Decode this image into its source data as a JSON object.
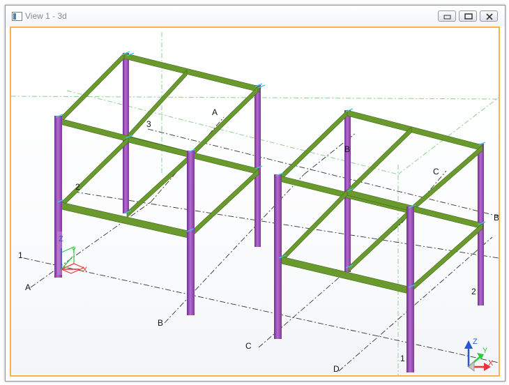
{
  "window": {
    "title": "View 1 - 3d"
  },
  "grid_labels": {
    "left_frame": {
      "row_1": "1",
      "row_2": "2",
      "row_3": "3",
      "col_a_bottom": "A",
      "col_a_top": "A",
      "col_b_bottom": "B"
    },
    "right_frame": {
      "col_b_top": "B",
      "col_c_top": "C",
      "col_c_bottom": "C",
      "col_d_bottom": "D",
      "col_b_right": "B",
      "row_2": "2",
      "row_1": "1"
    }
  },
  "axes": {
    "local": {
      "x": "X",
      "y": "Y",
      "z": "Z"
    },
    "global": {
      "x": "X",
      "y": "Y",
      "z": "Z"
    }
  },
  "colors": {
    "beam": "#6a9a2e",
    "column": "#9a47b5",
    "viewport_border": "#f5b54a",
    "grid_line": "#333333",
    "work_area_line": "#8fd08f"
  }
}
